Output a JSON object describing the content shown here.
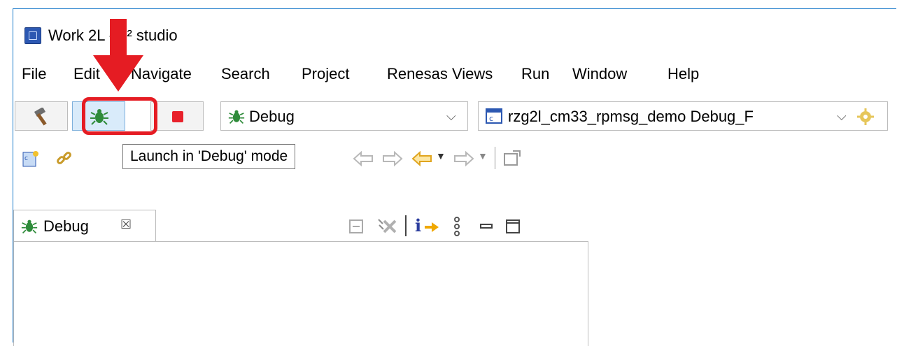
{
  "window": {
    "title": "Work 2L - e² studio",
    "icon": "e2-studio-app-icon"
  },
  "menubar": {
    "items": [
      "File",
      "Edit",
      "Navigate",
      "Search",
      "Project",
      "Renesas Views",
      "Run",
      "Window",
      "Help"
    ]
  },
  "toolbar": {
    "build_icon": "hammer-icon",
    "debug_icon": "bug-icon",
    "stop_icon": "stop-icon",
    "launch_mode": "Debug",
    "launch_config": "rzg2l_cm33_rpmsg_demo Debug_F",
    "config_settings_icon": "gear-icon"
  },
  "tooltip": {
    "text": "Launch in 'Debug' mode"
  },
  "debug_view": {
    "tab_label": "Debug",
    "tab_close": "☒"
  },
  "colors": {
    "highlight": "#e51c23",
    "window_border": "#1979ca",
    "debug_button_bg": "#d9ebfa",
    "bug_green": "#2e8b3a"
  }
}
